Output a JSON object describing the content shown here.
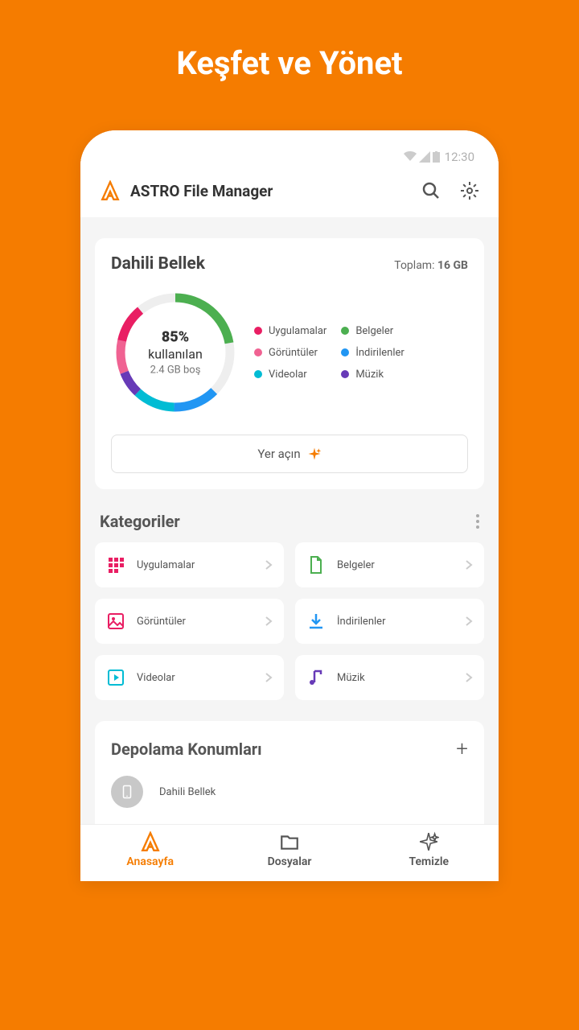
{
  "hero_title": "Keşfet ve Yönet",
  "status": {
    "time": "12:30"
  },
  "appbar": {
    "title": "ASTRO File Manager"
  },
  "storage": {
    "title": "Dahili Bellek",
    "total_label": "Toplam:",
    "total_value": "16 GB",
    "used_pct": "85%",
    "used_label": "kullanılan",
    "free": "2.4 GB boş",
    "legend": [
      {
        "label": "Uygulamalar",
        "color": "#e91e63"
      },
      {
        "label": "Belgeler",
        "color": "#4caf50"
      },
      {
        "label": "Görüntüler",
        "color": "#f06292"
      },
      {
        "label": "İndirilenler",
        "color": "#2196f3"
      },
      {
        "label": "Videolar",
        "color": "#00bcd4"
      },
      {
        "label": "Müzik",
        "color": "#673ab7"
      }
    ],
    "free_up_label": "Yer açın"
  },
  "categories": {
    "title": "Kategoriler",
    "items": [
      {
        "label": "Uygulamalar",
        "icon": "apps-icon",
        "color": "#e91e63"
      },
      {
        "label": "Belgeler",
        "icon": "document-icon",
        "color": "#4caf50"
      },
      {
        "label": "Görüntüler",
        "icon": "image-icon",
        "color": "#e91e63"
      },
      {
        "label": "İndirilenler",
        "icon": "download-icon",
        "color": "#2196f3"
      },
      {
        "label": "Videolar",
        "icon": "video-icon",
        "color": "#00bcd4"
      },
      {
        "label": "Müzik",
        "icon": "music-icon",
        "color": "#673ab7"
      }
    ]
  },
  "locations": {
    "title": "Depolama Konumları",
    "items": [
      {
        "label": "Dahili Bellek"
      }
    ]
  },
  "nav": {
    "home": "Anasayfa",
    "files": "Dosyalar",
    "clean": "Temizle"
  },
  "colors": {
    "accent": "#f57c00"
  }
}
